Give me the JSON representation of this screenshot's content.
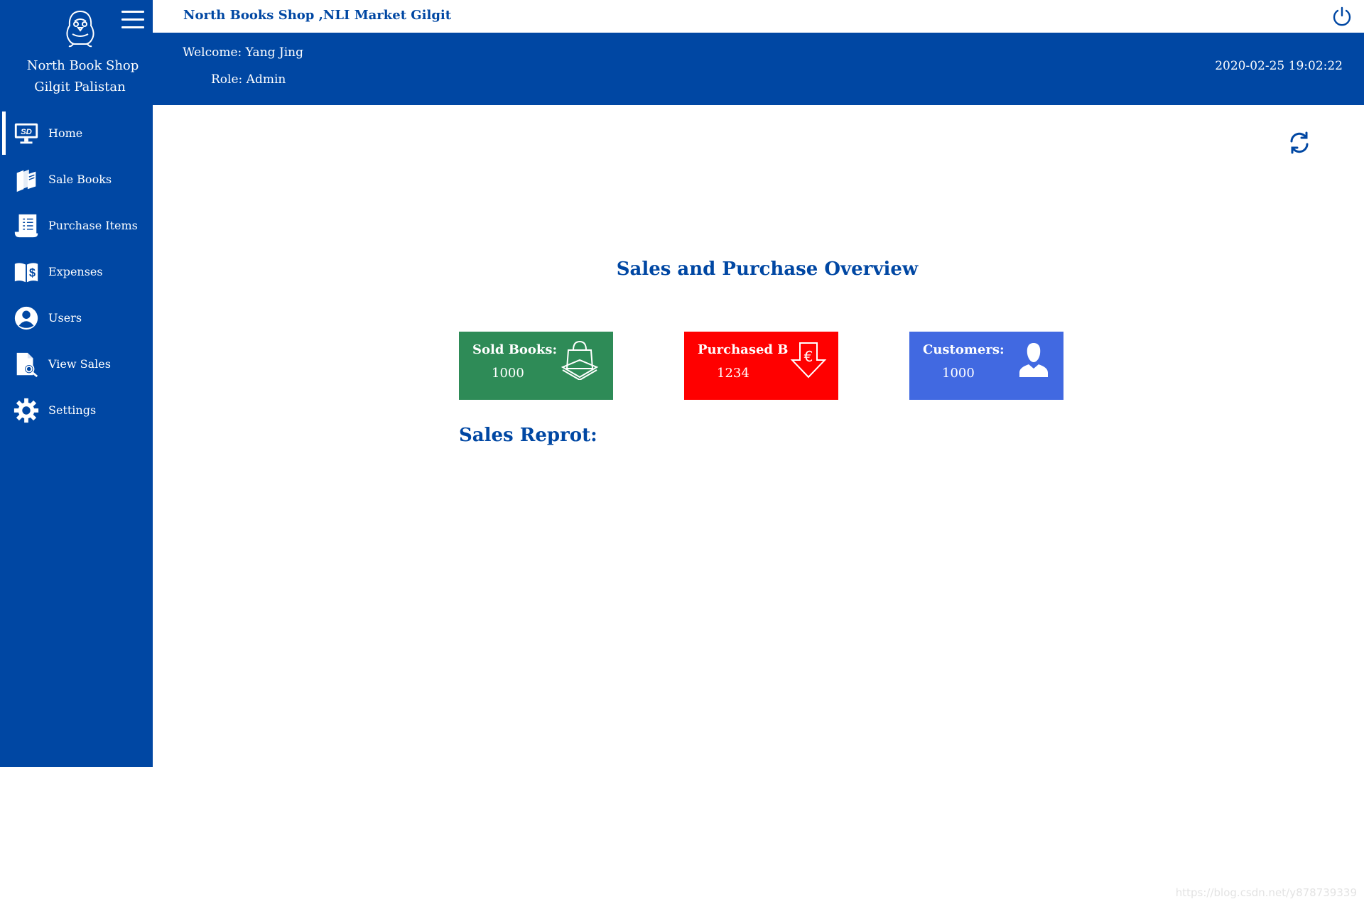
{
  "sidebar": {
    "logo_icon": "penguin-icon",
    "shop_name": "North Book Shop",
    "shop_location": "Gilgit Palistan",
    "items": [
      {
        "label": "Home",
        "icon": "home-monitor-icon",
        "active": true
      },
      {
        "label": "Sale Books",
        "icon": "books-icon",
        "active": false
      },
      {
        "label": "Purchase Items",
        "icon": "receipt-icon",
        "active": false
      },
      {
        "label": "Expenses",
        "icon": "dollar-book-icon",
        "active": false
      },
      {
        "label": "Users",
        "icon": "user-icon",
        "active": false
      },
      {
        "label": "View Sales",
        "icon": "document-search-icon",
        "active": false
      },
      {
        "label": "Settings",
        "icon": "gear-icon",
        "active": false
      }
    ]
  },
  "header": {
    "title": "North Books Shop ,NLI Market Gilgit",
    "welcome_label": "Welcome:",
    "welcome_value": "Yang Jing",
    "role_label": "Role:",
    "role_value": "Admin",
    "datetime": "2020-02-25 19:02:22"
  },
  "main": {
    "overview_title": "Sales and Purchase Overview",
    "cards": [
      {
        "caption": "Sold Books:",
        "value": "1000",
        "icon": "shopping-bag-icon",
        "color": "#2e8b57"
      },
      {
        "caption": "Purchased Bo",
        "value": "1234",
        "icon": "euro-arrow-down-icon",
        "color": "#ff0000"
      },
      {
        "caption": "Customers:",
        "value": "1000",
        "icon": "person-icon",
        "color": "#4169e1"
      }
    ],
    "sales_report_title": "Sales Reprot:"
  },
  "watermark": "https://blog.csdn.net/y878739339",
  "colors": {
    "primary": "#0047a3",
    "background": "#ffffff"
  }
}
